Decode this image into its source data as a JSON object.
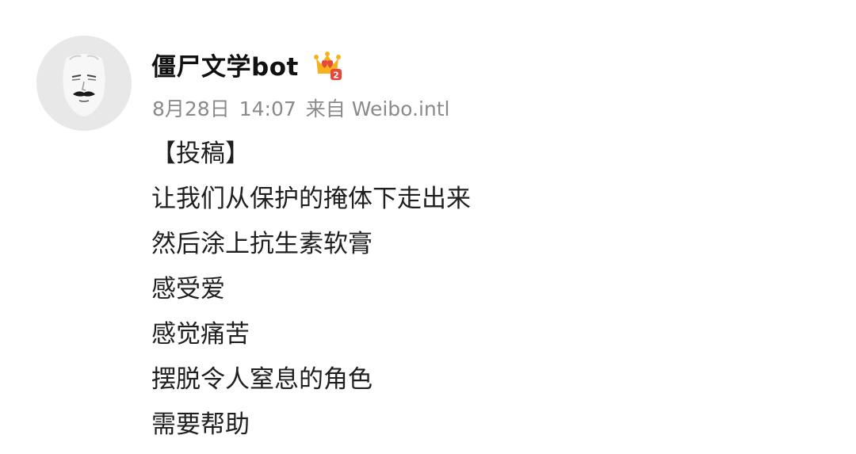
{
  "post": {
    "author": {
      "name": "僵尸文学bot",
      "avatar_icon": "sketch-face-avatar",
      "badge_icon": "crown-member-badge",
      "badge_level": "2"
    },
    "meta": {
      "date": "8月28日",
      "time": "14:07",
      "source": "来自 Weibo.intl"
    },
    "content": {
      "lines": [
        "【投稿】",
        "让我们从保护的掩体下走出来",
        "然后涂上抗生素软膏",
        "感受爱",
        "感觉痛苦",
        "摆脱令人窒息的角色",
        "需要帮助"
      ]
    }
  },
  "colors": {
    "background": "#ffffff",
    "username": "#111111",
    "meta_text": "#8a8a8a",
    "body_text": "#1f1f1f",
    "avatar_bg": "#e8e8e8",
    "badge_gold": "#f5b21c",
    "badge_red": "#e8483b"
  }
}
